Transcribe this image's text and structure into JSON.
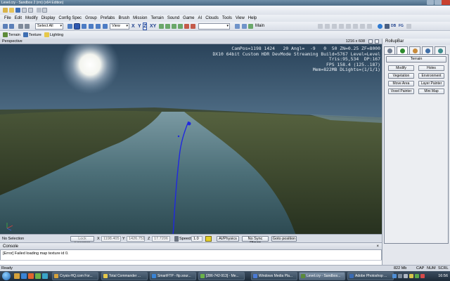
{
  "window": {
    "title": "Level.cry - Sandbox 2 (rm) (x64 Edition)"
  },
  "menu": [
    "File",
    "Edit",
    "Modify",
    "Display",
    "Config Spec",
    "Group",
    "Prefabs",
    "Brush",
    "Mission",
    "Terrain",
    "Sound",
    "Game",
    "AI",
    "Clouds",
    "Tools",
    "View",
    "Help"
  ],
  "toolbar2": {
    "selection_combo": "Select All",
    "view_combo": "View",
    "axes": [
      "X",
      "Y",
      "Z",
      "XY"
    ],
    "layer_combo": "Main"
  },
  "toolbar3": {
    "terrain": "Terrain",
    "texture": "Texture",
    "lighting": "Lighting"
  },
  "toolbar_right": {
    "db": "DB",
    "fg": "FG"
  },
  "viewport": {
    "title": "Perspective",
    "resolution": "1216 x 608",
    "hud": [
      "CamPos=1198 1424   20 Angl=  -9   0  50 ZN=0.25 ZF=8000",
      "DX10 64bit Custom HDR DevMode Streaming Build=5767 Level=Level",
      "Tris:95,534  DP:167",
      "FPS 158.4 (125..187)",
      "Mem=822MB DLights=(1/1/1)"
    ]
  },
  "statusline": {
    "selection": "No Selection",
    "lock_selection": "Lock Selection",
    "x_label": "X",
    "x_value": "1198.405",
    "y_label": "Y",
    "y_value": "1426.751",
    "z_label": "Z",
    "z_value": "17.7206",
    "speed_label": "Speed:",
    "speed_value": "1.0",
    "ai_physics": "AI/Physics",
    "no_sync_player": "No Sync Player",
    "goto_position": "Goto position"
  },
  "console": {
    "title": "Console",
    "lines": [
      "[Error] Failed loading map texture id 0."
    ]
  },
  "rollup": {
    "title": "RollupBar",
    "section": "Terrain",
    "tools": [
      "Modify",
      "Holes",
      "Vegetation",
      "Environment",
      "Move Area",
      "Layer Painter",
      "Voxel Painter",
      "Mini Map"
    ]
  },
  "appstatus": {
    "left": "Ready",
    "mem": "822 Mb",
    "caps": "CAP",
    "num": "NUM",
    "scrl": "SCRL"
  },
  "taskbar": {
    "tasks": [
      "Crysis-HQ.com For...",
      "Total Commander ...",
      "SmartFTP - ftp.sour...",
      "[286-742-913] - Me...",
      "Windows Media Pla...",
      "Level.cry - Sandbox...",
      "Adobe Photoshop ..."
    ],
    "clock": "16:56"
  },
  "colors": {
    "accent": "#3a73c8",
    "sky_top": "#2e4a63",
    "water": "#4f7480",
    "terrain": "#3b4a30",
    "path": "#1f2ad6"
  }
}
